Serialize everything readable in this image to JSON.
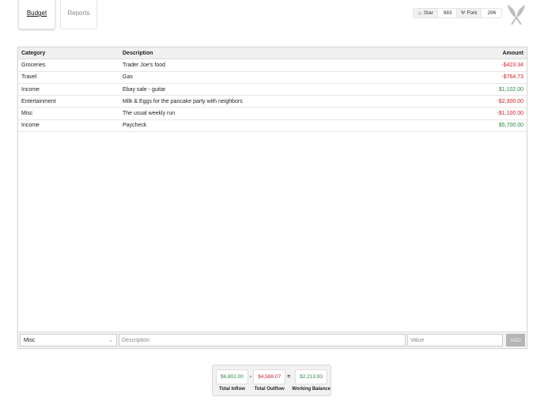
{
  "tabs": [
    {
      "label": "Budget",
      "active": true
    },
    {
      "label": "Reports",
      "active": false
    }
  ],
  "github": {
    "star_label": "Star",
    "star_count": "983",
    "fork_label": "Fork",
    "fork_count": "296"
  },
  "table": {
    "headers": [
      "Category",
      "Description",
      "Amount"
    ],
    "rows": [
      {
        "category": "Groceries",
        "description": "Trader Joe's food",
        "amount": "-$423.34"
      },
      {
        "category": "Travel",
        "description": "Gas",
        "amount": "-$764.73"
      },
      {
        "category": "Income",
        "description": "Ebay sale - guitar",
        "amount": "$1,102.00"
      },
      {
        "category": "Entertainment",
        "description": "Milk & Eggs for the pancake party with neighbors",
        "amount": "-$2,300.00"
      },
      {
        "category": "Misc",
        "description": "The usual weekly run",
        "amount": "-$1,100.00"
      },
      {
        "category": "Income",
        "description": "Paycheck",
        "amount": "$5,700.00"
      }
    ]
  },
  "form": {
    "category_value": "Misc",
    "description_placeholder": "Description",
    "value_placeholder": "Value",
    "add_label": "ADD"
  },
  "summary": {
    "inflow": "$6,802.00",
    "inflow_label": "Total Inflow",
    "minus": "-",
    "outflow": "$4,588.07",
    "outflow_label": "Total Outflow",
    "equals": "=",
    "balance": "$2,213.93",
    "balance_label": "Working Balance"
  },
  "colors": {
    "negative": "#d0212b",
    "positive": "#2a8a3e"
  }
}
